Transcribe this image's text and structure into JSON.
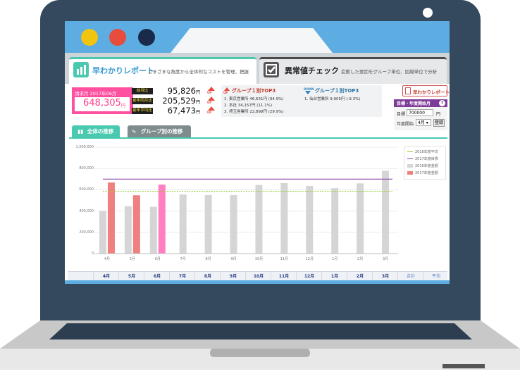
{
  "window": {
    "dots": [
      {
        "color": "#f1c40f"
      },
      {
        "color": "#e74c3c"
      },
      {
        "color": "#1a2a4a"
      }
    ]
  },
  "tabs": {
    "report": {
      "title": "早わかりレポート",
      "desc": "さまざまな角度から全体的なコストを管理、把握"
    },
    "anomaly": {
      "title": "異常値チェック",
      "desc": "変動した要因をグループ単位、回線単位で分析"
    }
  },
  "summary": {
    "month_label": "請求月 2017年06月",
    "amount": "648,305",
    "yen": "円",
    "metrics": [
      {
        "label": "前月比",
        "value": "95,826",
        "unit": "円",
        "arrow": "UP"
      },
      {
        "label": "前年同月比",
        "value": "205,529",
        "unit": "円",
        "arrow": "UP"
      },
      {
        "label": "前年平均比",
        "value": "67,473",
        "unit": "円",
        "arrow": "UP"
      }
    ]
  },
  "group_up": {
    "arrow": "UP",
    "title": "グループ１別TOP3",
    "items": [
      "1. 東京営業所 46,631円 (94.9%)",
      "2. 本社 34,157円 (11.1%)",
      "3. 埼玉営業所 22,898円 (29.9%)"
    ]
  },
  "group_down": {
    "arrow": "DOWN",
    "title": "グループ１別TOP3",
    "items": [
      "1. 仙台営業所 9,905円 (-9.3%)"
    ]
  },
  "side": {
    "report_button": "早わかりレポート",
    "settings_title": "目標・年度開始月",
    "help": "?",
    "target_label": "目標",
    "target_value": "700000",
    "target_unit": "円",
    "start_label": "年度開始",
    "start_value": "4月",
    "register": "登録"
  },
  "chart_tabs": {
    "all": "全体の推移",
    "group": "グループ別の推移"
  },
  "chart_data": {
    "type": "bar",
    "categories": [
      "4月",
      "5月",
      "6月",
      "7月",
      "8月",
      "9月",
      "10月",
      "11月",
      "12月",
      "1月",
      "2月",
      "3月"
    ],
    "series": [
      {
        "name": "2016年度金額",
        "values": [
          400000,
          445000,
          440000,
          555000,
          550000,
          550000,
          645000,
          662000,
          636000,
          615000,
          660000,
          778000
        ],
        "color": "#d5d5d5"
      },
      {
        "name": "2017年度金額",
        "values": [
          668000,
          548000,
          648305,
          null,
          null,
          null,
          null,
          null,
          null,
          null,
          null,
          null
        ],
        "color": "#f08080"
      }
    ],
    "lines": [
      {
        "name": "2016年度平均",
        "value": 585000,
        "color": "#9acd32",
        "style": "dashed"
      },
      {
        "name": "2017年度目標",
        "value": 700000,
        "color": "#8e44ad",
        "style": "solid"
      }
    ],
    "yticks": [
      "1,000,000",
      "800,000",
      "600,000",
      "400,000",
      "200,000",
      "0"
    ],
    "ylim": [
      0,
      1000000
    ],
    "grid": true,
    "legend_position": "top-right"
  },
  "table": {
    "months": [
      "4月",
      "5月",
      "6月",
      "7月",
      "8月",
      "9月",
      "10月",
      "11月",
      "12月",
      "1月",
      "2月",
      "3月"
    ],
    "total": "合計",
    "average": "平均"
  }
}
